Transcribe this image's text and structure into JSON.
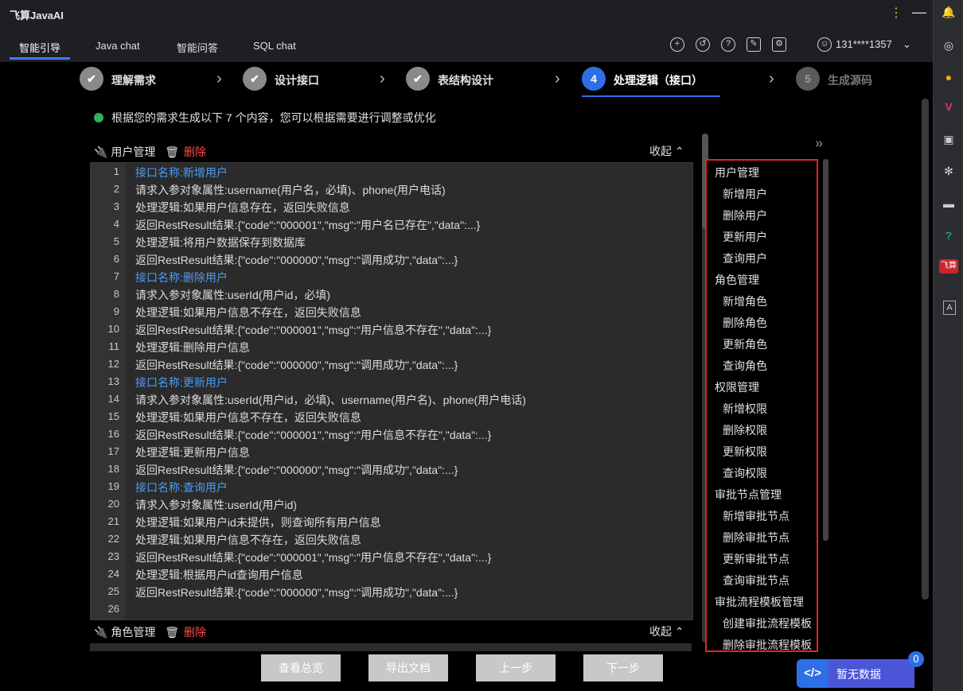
{
  "app": {
    "title": "飞算JavaAI"
  },
  "tabs": [
    {
      "label": "智能引导"
    },
    {
      "label": "Java chat"
    },
    {
      "label": "智能问答"
    },
    {
      "label": "SQL chat"
    }
  ],
  "user": {
    "label": "131****1357"
  },
  "steps": [
    {
      "label": "理解需求",
      "marker": "✔"
    },
    {
      "label": "设计接口",
      "marker": "✔"
    },
    {
      "label": "表结构设计",
      "marker": "✔"
    },
    {
      "label": "处理逻辑（接口）",
      "marker": "4"
    },
    {
      "label": "生成源码",
      "marker": "5"
    }
  ],
  "info": "根据您的需求生成以下 7 个内容，您可以根据需要进行调整或优化",
  "sections": [
    {
      "title": "用户管理",
      "delete_label": "删除",
      "collapse_label": "收起"
    },
    {
      "title": "角色管理",
      "delete_label": "删除",
      "collapse_label": "收起"
    }
  ],
  "code_lines": [
    {
      "n": "1",
      "t": "接口名称:新增用户",
      "h": true
    },
    {
      "n": "2",
      "t": "请求入参对象属性:username(用户名，必填)、phone(用户电话)"
    },
    {
      "n": "3",
      "t": "处理逻辑:如果用户信息存在，返回失败信息"
    },
    {
      "n": "4",
      "t": "返回RestResult结果:{\"code\":\"000001\",\"msg\":\"用户名已存在\",\"data\":...}"
    },
    {
      "n": "5",
      "t": "处理逻辑:将用户数据保存到数据库"
    },
    {
      "n": "6",
      "t": "返回RestResult结果:{\"code\":\"000000\",\"msg\":\"调用成功\",\"data\":...}"
    },
    {
      "n": "7",
      "t": "接口名称:删除用户",
      "h": true
    },
    {
      "n": "8",
      "t": "请求入参对象属性:userId(用户id，必填)"
    },
    {
      "n": "9",
      "t": "处理逻辑:如果用户信息不存在，返回失败信息"
    },
    {
      "n": "10",
      "t": "返回RestResult结果:{\"code\":\"000001\",\"msg\":\"用户信息不存在\",\"data\":...}"
    },
    {
      "n": "11",
      "t": "处理逻辑:删除用户信息"
    },
    {
      "n": "12",
      "t": "返回RestResult结果:{\"code\":\"000000\",\"msg\":\"调用成功\",\"data\":...}"
    },
    {
      "n": "13",
      "t": "接口名称:更新用户",
      "h": true
    },
    {
      "n": "14",
      "t": "请求入参对象属性:userId(用户id，必填)、username(用户名)、phone(用户电话)"
    },
    {
      "n": "15",
      "t": "处理逻辑:如果用户信息不存在，返回失败信息"
    },
    {
      "n": "16",
      "t": "返回RestResult结果:{\"code\":\"000001\",\"msg\":\"用户信息不存在\",\"data\":...}"
    },
    {
      "n": "17",
      "t": "处理逻辑:更新用户信息"
    },
    {
      "n": "18",
      "t": "返回RestResult结果:{\"code\":\"000000\",\"msg\":\"调用成功\",\"data\":...}"
    },
    {
      "n": "19",
      "t": "接口名称:查询用户",
      "h": true
    },
    {
      "n": "20",
      "t": "请求入参对象属性:userId(用户id)"
    },
    {
      "n": "21",
      "t": "处理逻辑:如果用户id未提供，则查询所有用户信息"
    },
    {
      "n": "22",
      "t": "处理逻辑:如果用户信息不存在，返回失败信息"
    },
    {
      "n": "23",
      "t": "返回RestResult结果:{\"code\":\"000001\",\"msg\":\"用户信息不存在\",\"data\":...}"
    },
    {
      "n": "24",
      "t": "处理逻辑:根据用户id查询用户信息"
    },
    {
      "n": "25",
      "t": "返回RestResult结果:{\"code\":\"000000\",\"msg\":\"调用成功\",\"data\":...}"
    },
    {
      "n": "26",
      "t": ""
    }
  ],
  "outline": [
    {
      "label": "用户管理",
      "child": false
    },
    {
      "label": "新增用户",
      "child": true
    },
    {
      "label": "删除用户",
      "child": true
    },
    {
      "label": "更新用户",
      "child": true
    },
    {
      "label": "查询用户",
      "child": true
    },
    {
      "label": "角色管理",
      "child": false
    },
    {
      "label": "新增角色",
      "child": true
    },
    {
      "label": "删除角色",
      "child": true
    },
    {
      "label": "更新角色",
      "child": true
    },
    {
      "label": "查询角色",
      "child": true
    },
    {
      "label": "权限管理",
      "child": false
    },
    {
      "label": "新增权限",
      "child": true
    },
    {
      "label": "删除权限",
      "child": true
    },
    {
      "label": "更新权限",
      "child": true
    },
    {
      "label": "查询权限",
      "child": true
    },
    {
      "label": "审批节点管理",
      "child": false
    },
    {
      "label": "新增审批节点",
      "child": true
    },
    {
      "label": "删除审批节点",
      "child": true
    },
    {
      "label": "更新审批节点",
      "child": true
    },
    {
      "label": "查询审批节点",
      "child": true
    },
    {
      "label": "审批流程模板管理",
      "child": false
    },
    {
      "label": "创建审批流程模板",
      "child": true
    },
    {
      "label": "删除审批流程模板",
      "child": true
    }
  ],
  "buttons": {
    "overview": "查看总览",
    "export": "导出文档",
    "prev": "上一步",
    "next": "下一步"
  },
  "no_data": {
    "label": "暂无数据",
    "count": "0",
    "icon": "</>"
  },
  "right_toolbar_icons": [
    "bell-icon",
    "chat-icon",
    "database-icon",
    "v-icon",
    "package-icon",
    "network-icon",
    "panel-icon",
    "help-icon",
    "feisuan-icon",
    "a-icon"
  ],
  "right_toolbar": {
    "feisuan_label": "飞算",
    "a_label": "A",
    "v_label": "V",
    "help_label": "?"
  }
}
